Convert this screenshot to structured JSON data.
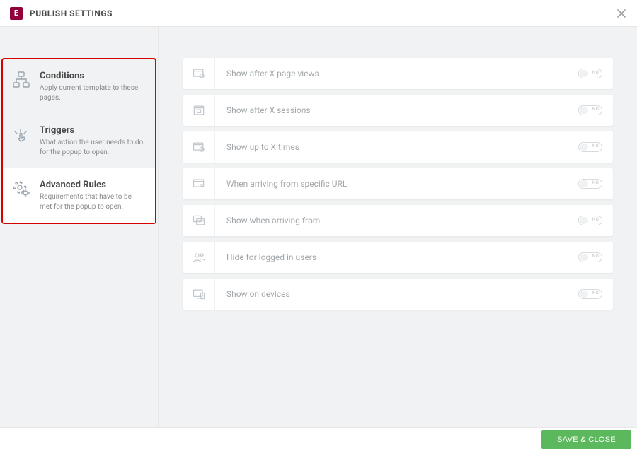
{
  "header": {
    "title": "PUBLISH SETTINGS"
  },
  "sidebar": {
    "items": [
      {
        "title": "Conditions",
        "desc": "Apply current template to these pages."
      },
      {
        "title": "Triggers",
        "desc": "What action the user needs to do for the popup to open."
      },
      {
        "title": "Advanced Rules",
        "desc": "Requirements that have to be met for the popup to open."
      }
    ]
  },
  "rules": [
    {
      "label": "Show after X page views",
      "toggle": "NO"
    },
    {
      "label": "Show after X sessions",
      "toggle": "NO"
    },
    {
      "label": "Show up to X times",
      "toggle": "NO"
    },
    {
      "label": "When arriving from specific URL",
      "toggle": "NO"
    },
    {
      "label": "Show when arriving from",
      "toggle": "NO"
    },
    {
      "label": "Hide for logged in users",
      "toggle": "NO"
    },
    {
      "label": "Show on devices",
      "toggle": "NO"
    }
  ],
  "footer": {
    "save_label": "SAVE & CLOSE"
  }
}
